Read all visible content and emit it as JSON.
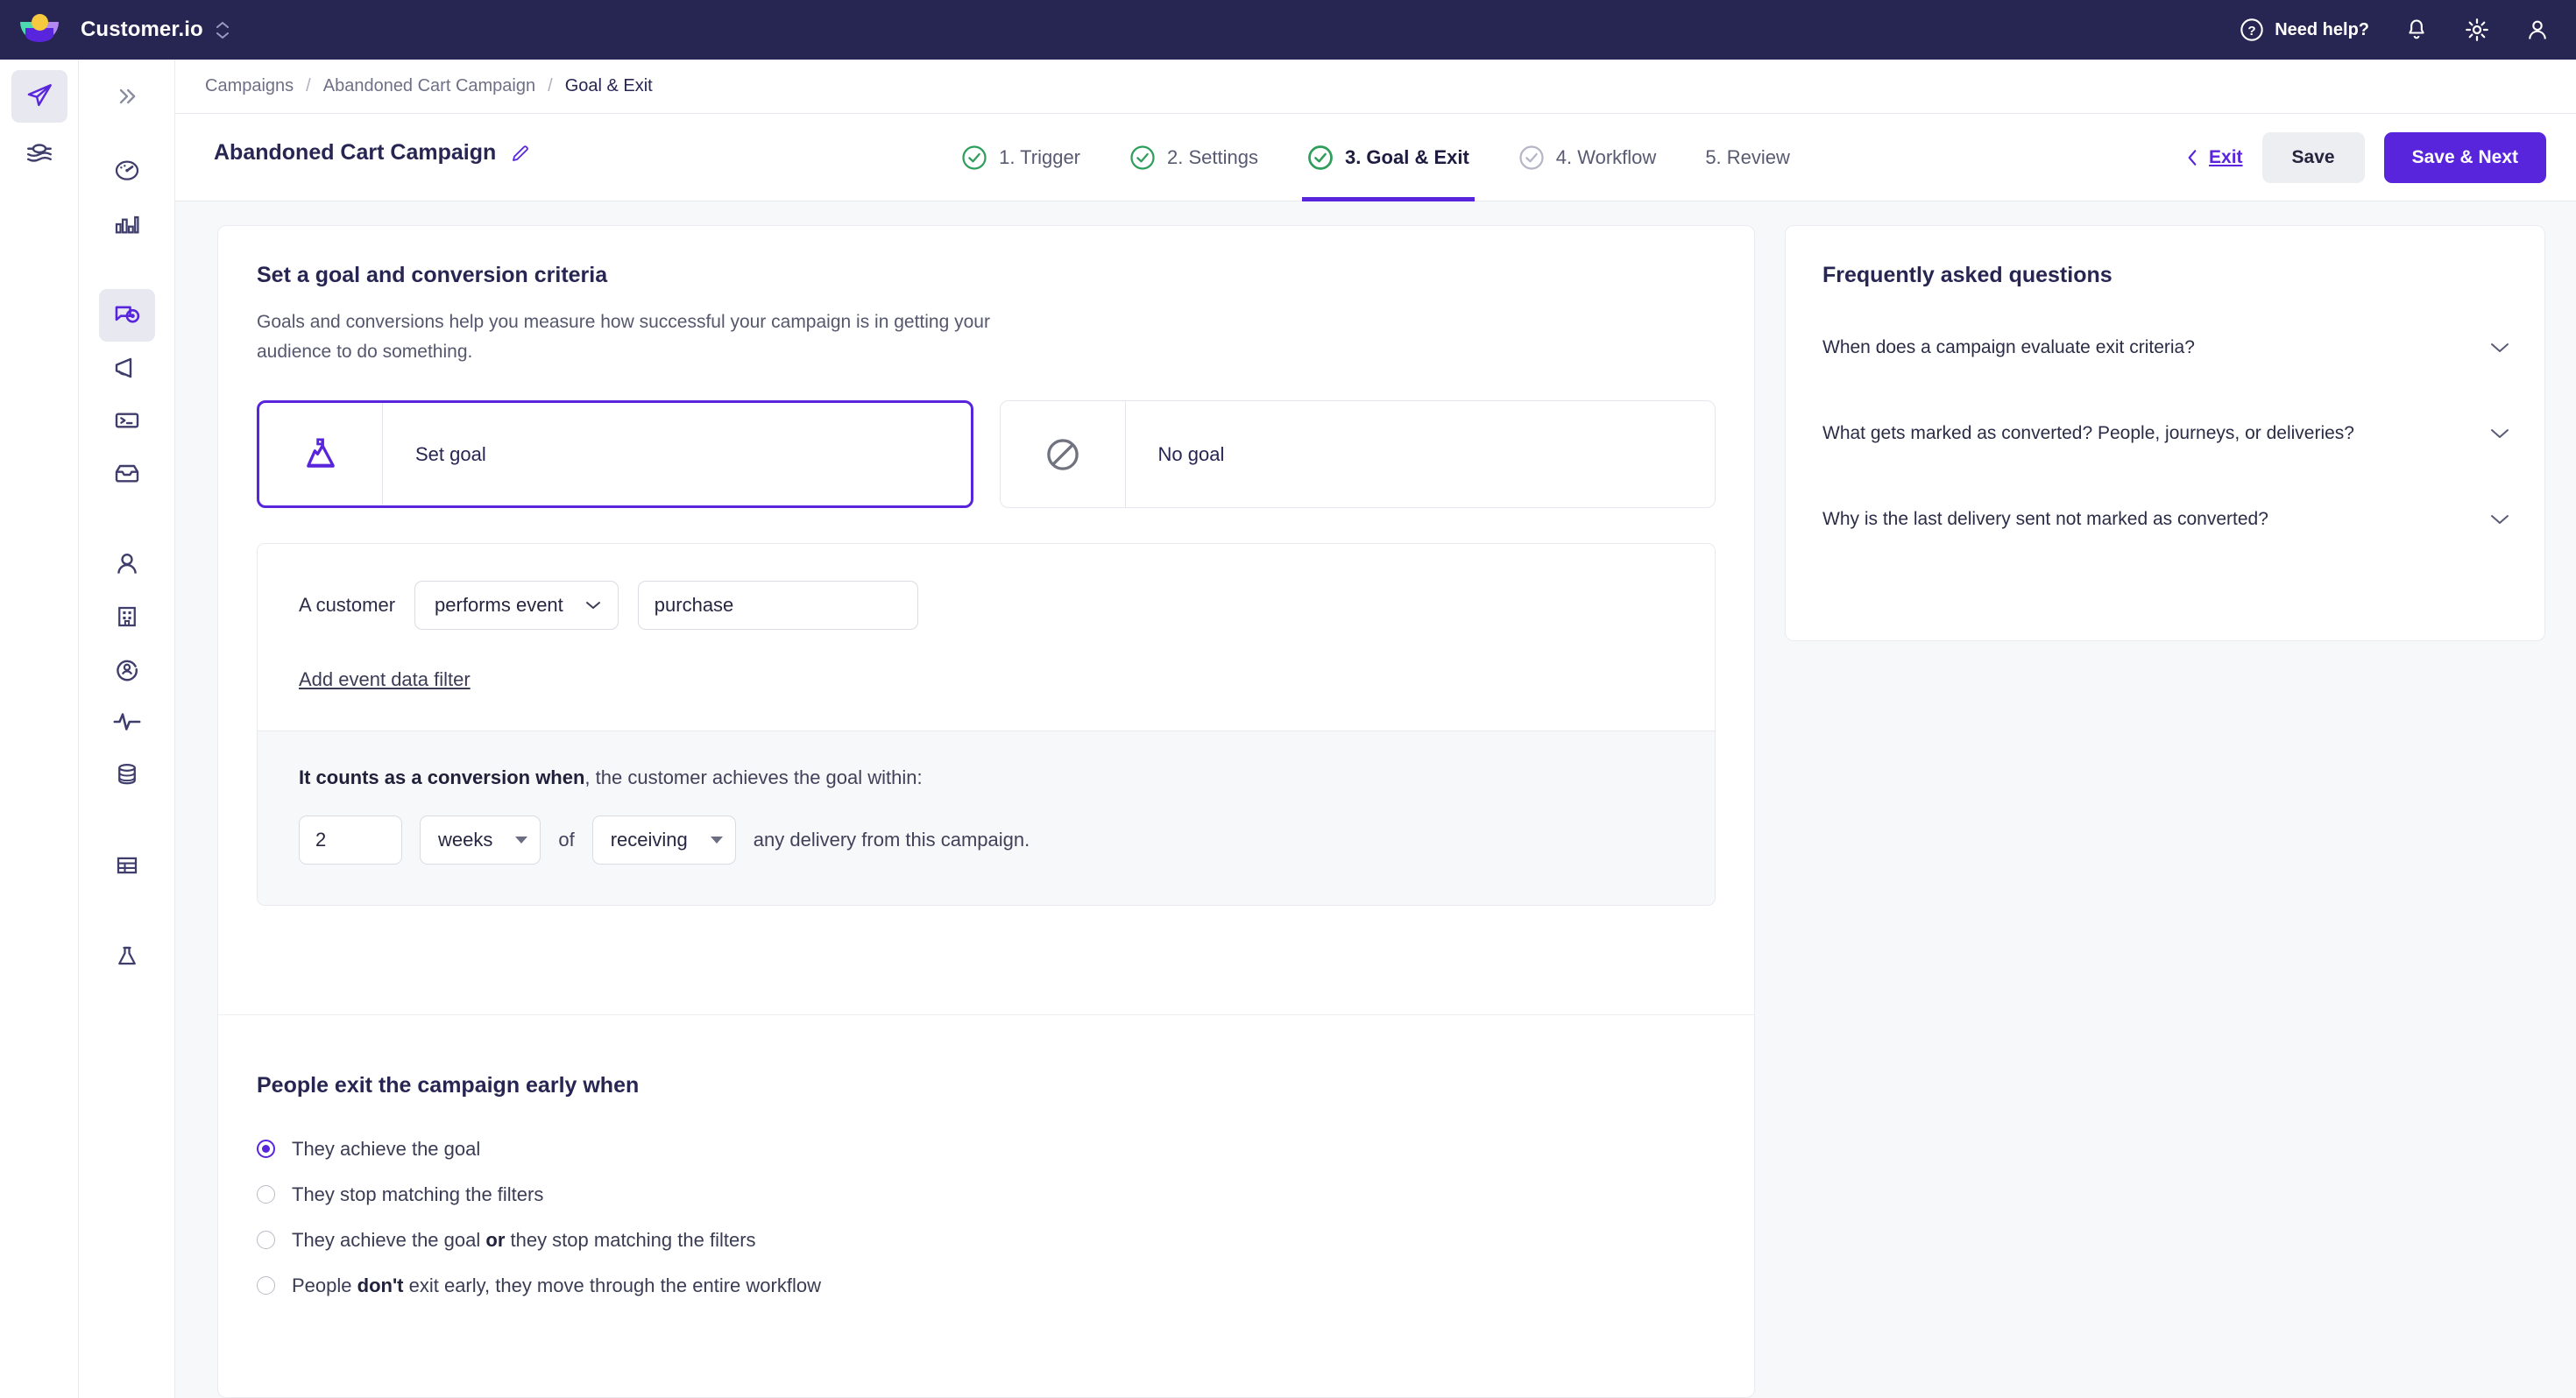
{
  "topbar": {
    "brand": "Customer.io",
    "need_help": "Need help?",
    "icons": [
      "help-circle-icon",
      "bell-icon",
      "gear-icon",
      "user-icon"
    ],
    "bg": "#272552"
  },
  "rail_primary": [
    {
      "name": "campaigns-rail-item",
      "icon": "paper-plane-icon",
      "active": true
    },
    {
      "name": "data-rail-item",
      "icon": "layers-icon",
      "active": false
    }
  ],
  "rail_secondary": [
    {
      "name": "expand-sidebar",
      "icon": "chevrons-right-icon",
      "active": false
    },
    {
      "name": "dashboard",
      "icon": "gauge-icon",
      "active": false
    },
    {
      "name": "analytics",
      "icon": "bar-chart-icon",
      "active": false
    },
    {
      "name": "campaigns",
      "icon": "campaign-target-icon",
      "active": true
    },
    {
      "name": "broadcasts",
      "icon": "megaphone-icon",
      "active": false
    },
    {
      "name": "api-triggered",
      "icon": "terminal-icon",
      "active": false
    },
    {
      "name": "newsletters",
      "icon": "inbox-icon",
      "active": false
    },
    {
      "name": "people",
      "icon": "person-icon",
      "active": false
    },
    {
      "name": "objects",
      "icon": "building-icon",
      "active": false
    },
    {
      "name": "segments",
      "icon": "user-circle-icon",
      "active": false
    },
    {
      "name": "activity-logs",
      "icon": "pulse-icon",
      "active": false
    },
    {
      "name": "data-index",
      "icon": "database-icon",
      "active": false
    },
    {
      "name": "collections",
      "icon": "table-icon",
      "active": false
    },
    {
      "name": "experiments",
      "icon": "flask-icon",
      "active": false
    }
  ],
  "breadcrumb": {
    "items": [
      "Campaigns",
      "Abandoned Cart Campaign",
      "Goal & Exit"
    ],
    "separator": "/"
  },
  "header": {
    "campaign_name": "Abandoned Cart Campaign",
    "edit_icon": "pencil-icon",
    "steps": [
      {
        "label": "1. Trigger",
        "state": "complete"
      },
      {
        "label": "2. Settings",
        "state": "complete"
      },
      {
        "label": "3. Goal & Exit",
        "state": "active"
      },
      {
        "label": "4. Workflow",
        "state": "incomplete"
      },
      {
        "label": "5. Review",
        "state": "pending"
      }
    ],
    "exit_label": "Exit",
    "save_label": "Save",
    "save_next_label": "Save & Next",
    "accent": "#5925dc",
    "complete_color": "#2e9e5b"
  },
  "goal_section": {
    "title": "Set a goal and conversion criteria",
    "description": "Goals and conversions help you measure how successful your campaign is in getting your audience to do something.",
    "options": [
      {
        "label": "Set goal",
        "icon": "mountain-flag-icon",
        "selected": true
      },
      {
        "label": "No goal",
        "icon": "no-entry-icon",
        "selected": false
      }
    ],
    "condition": {
      "prefix_label": "A customer",
      "operator_value": "performs event",
      "event_value": "purchase",
      "event_placeholder": "Event name",
      "add_filter_label": "Add event data filter"
    },
    "conversion": {
      "bold_lead": "It counts as a conversion when",
      "rest": ", the customer achieves the goal within:",
      "amount_value": "2",
      "unit_value": "weeks",
      "joiner": "of",
      "trigger_value": "receiving",
      "tail": "any delivery from this campaign."
    }
  },
  "exit_section": {
    "title": "People exit the campaign early when",
    "options": [
      {
        "text": "They achieve the goal",
        "selected": true
      },
      {
        "text": "They stop matching the filters",
        "selected": false
      },
      {
        "text_pre": "They achieve the goal ",
        "bold": "or",
        "text_post": " they stop matching the filters",
        "selected": false
      },
      {
        "text_pre": "People ",
        "bold": "don't",
        "text_post": " exit early, they move through the entire workflow",
        "selected": false
      }
    ]
  },
  "faq": {
    "title": "Frequently asked questions",
    "items": [
      {
        "question": "When does a campaign evaluate exit criteria?",
        "icon": "chevron-down-icon"
      },
      {
        "question": "What gets marked as converted? People, journeys, or deliveries?",
        "icon": "chevron-down-icon"
      },
      {
        "question": "Why is the last delivery sent not marked as converted?",
        "icon": "chevron-down-icon"
      }
    ]
  }
}
